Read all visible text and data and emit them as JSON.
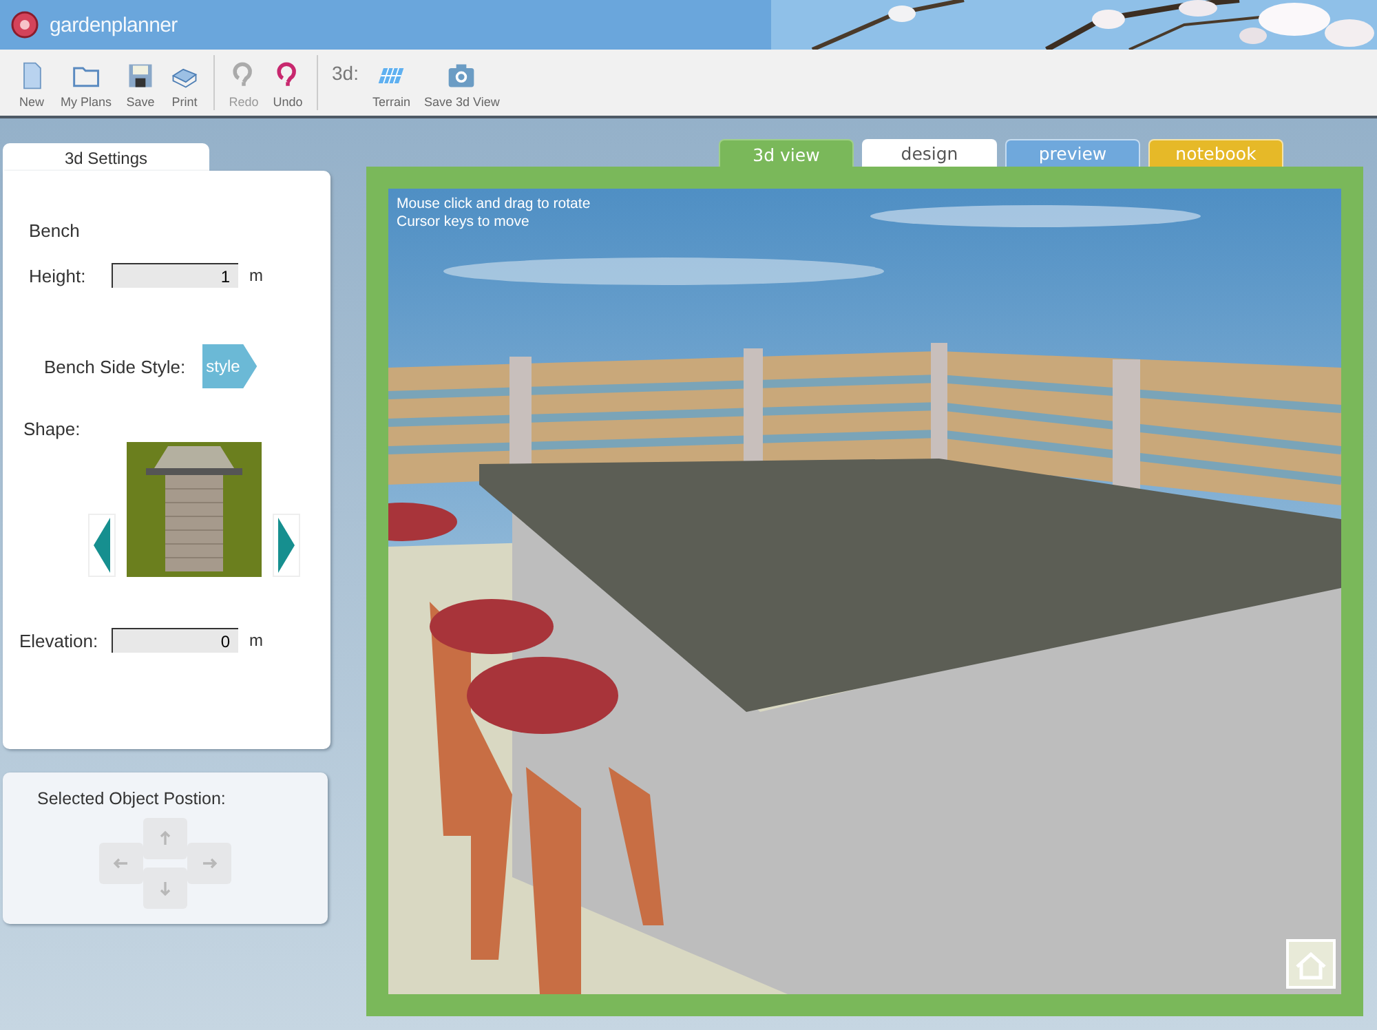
{
  "app": {
    "title": "gardenplanner"
  },
  "toolbar": {
    "groups": [
      {
        "items": [
          {
            "kind": "new",
            "label": "New",
            "disabled": false
          },
          {
            "kind": "open",
            "label": "My Plans",
            "disabled": false
          },
          {
            "kind": "save",
            "label": "Save",
            "disabled": false
          },
          {
            "kind": "print",
            "label": "Print",
            "disabled": false
          }
        ]
      },
      {
        "items": [
          {
            "kind": "redo",
            "label": "Redo",
            "disabled": true
          },
          {
            "kind": "undo",
            "label": "Undo",
            "disabled": false
          }
        ]
      },
      {
        "prefix": "3d:",
        "items": [
          {
            "kind": "terrain",
            "label": "Terrain",
            "disabled": false
          },
          {
            "kind": "camera",
            "label": "Save 3d View",
            "disabled": false
          }
        ]
      }
    ]
  },
  "settings_panel": {
    "tab": "3d Settings",
    "object_name": "Bench",
    "height": {
      "label": "Height:",
      "value": "1",
      "unit": "m"
    },
    "side_style": {
      "label": "Bench Side Style:",
      "button": "style"
    },
    "shape": {
      "label": "Shape:"
    },
    "elevation": {
      "label": "Elevation:",
      "value": "0",
      "unit": "m"
    }
  },
  "position_panel": {
    "title": "Selected Object Postion:",
    "arrows": [
      {
        "kind": "up",
        "disabled": true
      },
      {
        "kind": "left",
        "disabled": true
      },
      {
        "kind": "right",
        "disabled": true
      },
      {
        "kind": "down",
        "disabled": true
      }
    ]
  },
  "view_tabs": [
    {
      "label": "3d view",
      "selected": true,
      "color": "#7ab85a"
    },
    {
      "label": "design",
      "selected": false,
      "color": "#ffffff"
    },
    {
      "label": "preview",
      "selected": false,
      "color": "#6fa8dc"
    },
    {
      "label": "notebook",
      "selected": false,
      "color": "#e6b928"
    }
  ],
  "viewport": {
    "hints": [
      "Mouse click and drag to rotate",
      "Cursor keys to move"
    ]
  }
}
